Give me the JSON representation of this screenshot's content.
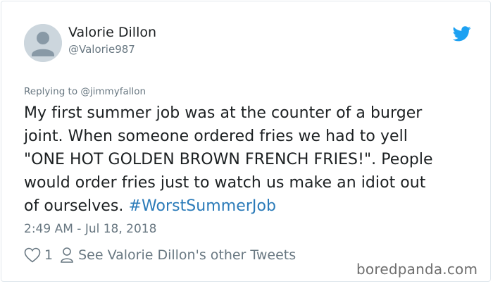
{
  "author": {
    "display_name": "Valorie Dillon",
    "handle": "@Valorie987",
    "avatar_icon": "default-avatar-icon"
  },
  "brand": {
    "icon": "twitter-bird-icon",
    "color": "#1da1f2"
  },
  "tweet": {
    "replying_to": "Replying to @jimmyfallon",
    "text": "My first summer job was at the counter of a burger\njoint. When someone ordered fries we had to yell\n\"ONE HOT GOLDEN BROWN FRENCH FRIES!\". People\nwould order fries just to watch us make an idiot out\nof ourselves. ",
    "hashtag": "#WorstSummerJob",
    "hashtag_color": "#2b7bb9",
    "timestamp": "2:49 AM - Jul 18, 2018"
  },
  "actions": {
    "like_icon": "heart-icon",
    "like_count": "1",
    "profile_icon": "person-icon",
    "profile_link": "See Valorie Dillon's other Tweets"
  },
  "watermark": "boredpanda.com"
}
